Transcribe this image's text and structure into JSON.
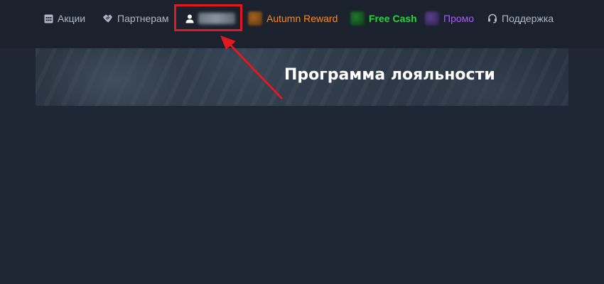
{
  "nav": {
    "promotions": {
      "label": "Акции",
      "icon": "calendar-icon"
    },
    "partners": {
      "label": "Партнерам",
      "icon": "handshake-icon"
    },
    "user": {
      "icon": "user-icon",
      "username": ""
    },
    "autumn_reward": {
      "label": "Autumn Reward",
      "color": "#ff8a1c"
    },
    "free_cash": {
      "label": "Free Cash",
      "color": "#28d33c"
    },
    "promo": {
      "label": "Промо",
      "color": "#a957ff"
    },
    "support": {
      "label": "Поддержка",
      "icon": "headset-icon"
    }
  },
  "banner": {
    "title": "Программа лояльности"
  },
  "annotation": {
    "highlight_color": "#e0181f"
  }
}
